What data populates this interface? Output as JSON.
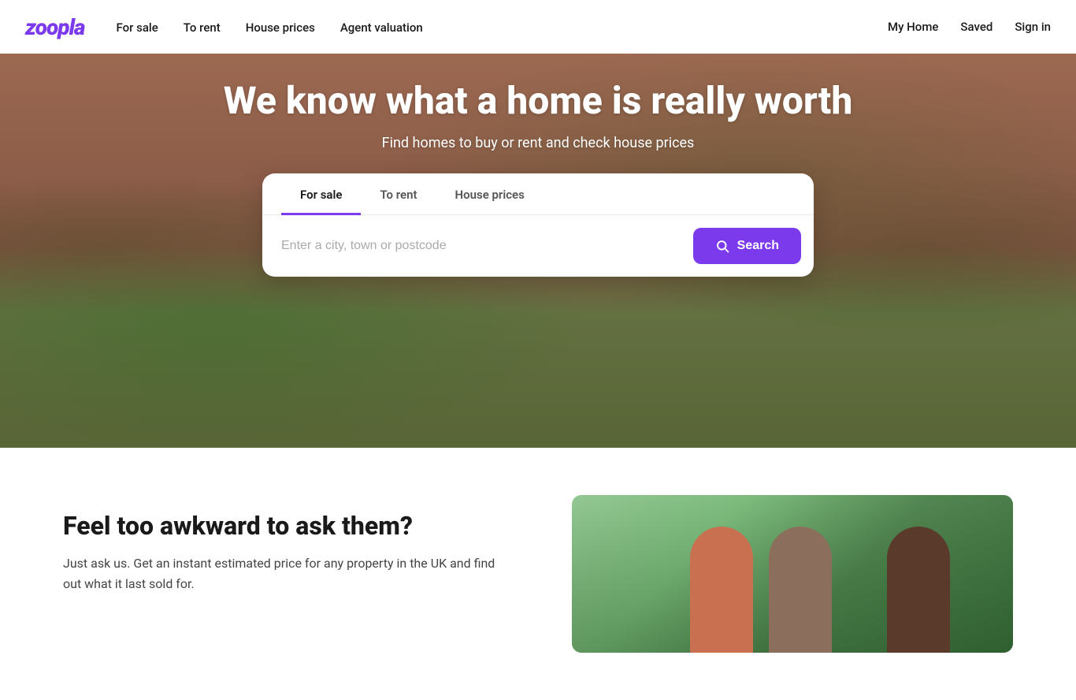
{
  "logo": {
    "text": "zoopla"
  },
  "nav": {
    "links": [
      {
        "label": "For sale",
        "href": "#"
      },
      {
        "label": "To rent",
        "href": "#"
      },
      {
        "label": "House prices",
        "href": "#"
      },
      {
        "label": "Agent valuation",
        "href": "#"
      }
    ]
  },
  "header_right": {
    "links": [
      {
        "label": "My Home",
        "href": "#"
      },
      {
        "label": "Saved",
        "href": "#"
      },
      {
        "label": "Sign in",
        "href": "#"
      }
    ]
  },
  "hero": {
    "title": "We know what a home is really worth",
    "subtitle": "Find homes to buy or rent and check house prices",
    "tabs": [
      {
        "label": "For sale",
        "active": true
      },
      {
        "label": "To rent",
        "active": false
      },
      {
        "label": "House prices",
        "active": false
      }
    ],
    "search_placeholder": "Enter a city, town or postcode",
    "search_button_label": "Search"
  },
  "below": {
    "title": "Feel too awkward to ask them?",
    "description": "Just ask us. Get an instant estimated price for any property in the UK and find out what it last sold for."
  }
}
